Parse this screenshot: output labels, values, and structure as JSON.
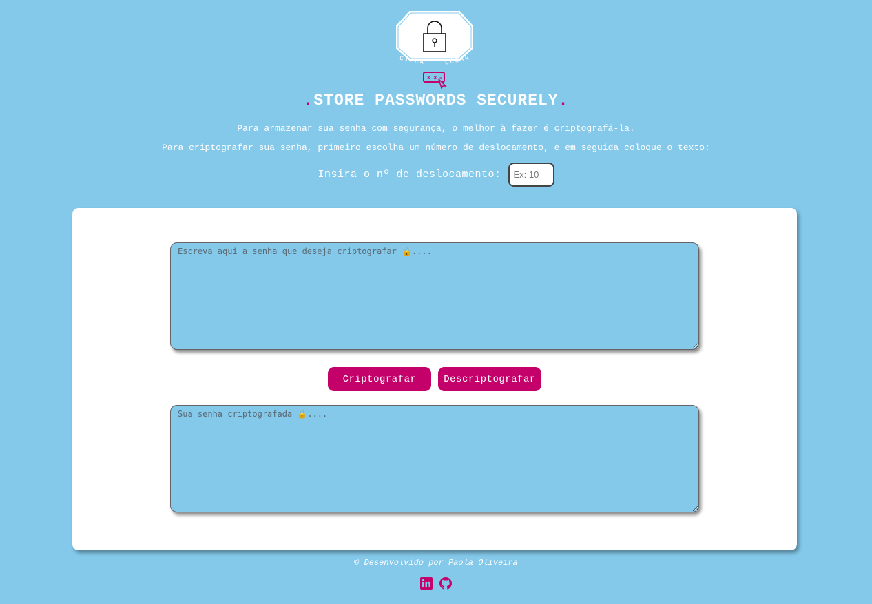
{
  "logo": {
    "text_left": "CIFRA",
    "text_right": "CÉSAR",
    "icon": "padlock-icon"
  },
  "header": {
    "title": "STORE PASSWORDS SECURELY",
    "title_dot_left": ".",
    "title_dot_right": ".",
    "accent_color": "#c4006b"
  },
  "intro": {
    "line1": "Para armazenar sua senha com segurança, o melhor à fazer é criptografá-la.",
    "line2": "Para criptografar sua senha, primeiro escolha um número de deslocamento, e em seguida coloque o texto:"
  },
  "shift": {
    "label": "Insira o nº de deslocamento:",
    "placeholder": "Ex: 10",
    "value": ""
  },
  "input_area": {
    "placeholder": "Escreva aqui a senha que deseja criptografar 🔒....",
    "value": ""
  },
  "actions": {
    "encrypt_label": "Criptografar",
    "decrypt_label": "Descriptografar"
  },
  "output_area": {
    "placeholder": "Sua senha criptografada 🔒....",
    "value": ""
  },
  "footer": {
    "credit": "© Desenvolvido por Paola Oliveira",
    "links": [
      {
        "icon": "linkedin-icon"
      },
      {
        "icon": "github-icon"
      }
    ]
  },
  "colors": {
    "background": "#84c8ea",
    "card": "#ffffff",
    "button": "#c4006b"
  }
}
